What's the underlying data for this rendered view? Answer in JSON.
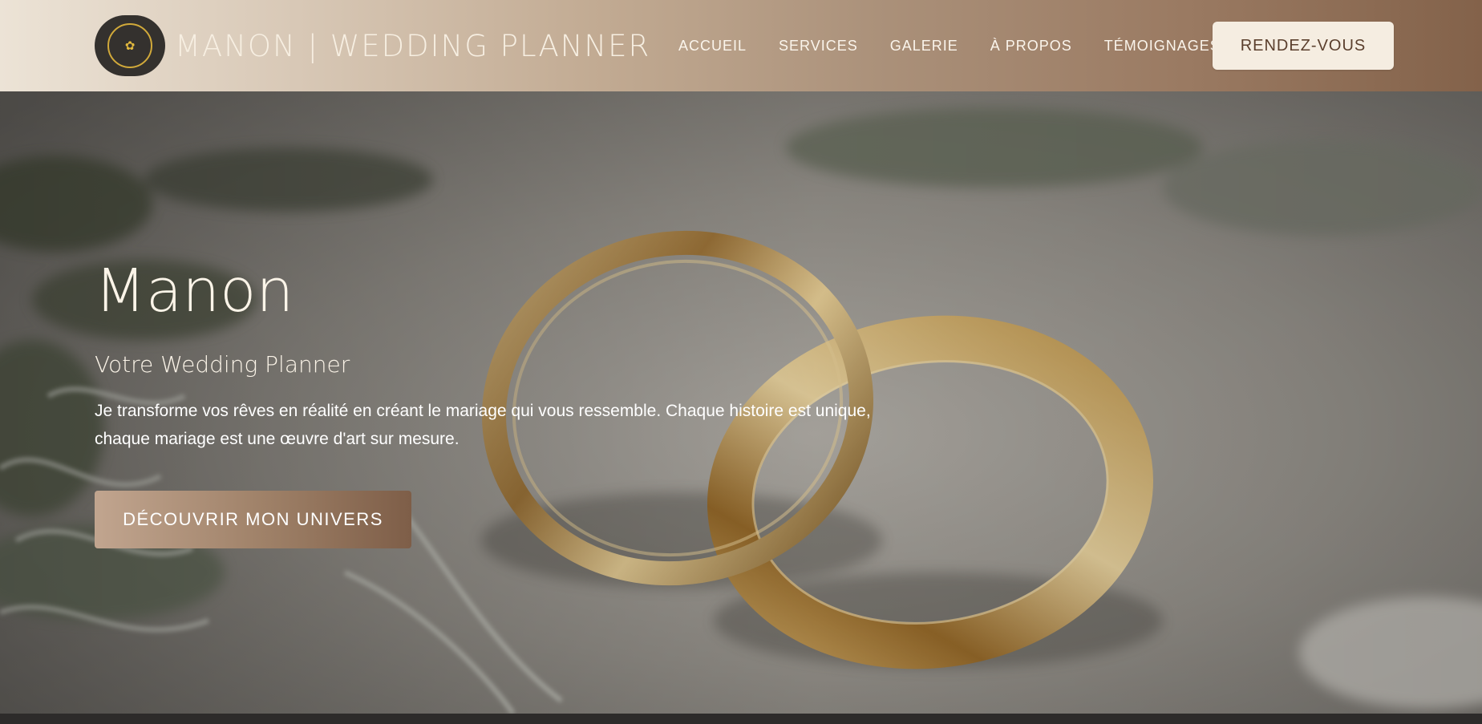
{
  "brand": {
    "logo_icon": "flower-icon",
    "logo_glyph": "✿",
    "name": "MANON | WEDDING PLANNER"
  },
  "nav": {
    "items": [
      {
        "label": "ACCUEIL"
      },
      {
        "label": "SERVICES"
      },
      {
        "label": "GALERIE"
      },
      {
        "label": "À PROPOS"
      },
      {
        "label": "TÉMOIGNAGES"
      }
    ],
    "cta_label": "RENDEZ-VOUS"
  },
  "hero": {
    "background_image": "wedding-rings-photo",
    "title": "Manon",
    "subtitle": "Votre Wedding Planner",
    "description": "Je transforme vos rêves en réalité en créant le mariage qui vous ressemble. Chaque histoire est unique, chaque mariage est une œuvre d'art sur mesure.",
    "cta_label": "DÉCOUVRIR MON UNIVERS"
  },
  "colors": {
    "header_gradient_start": "#ece3d6",
    "header_gradient_end": "#83624a",
    "accent_gold": "#d1a93a",
    "logo_bg": "#34312e",
    "header_button_bg": "#f5ede1",
    "header_button_text": "#5b3f2d",
    "hero_text": "#fbf4e8"
  }
}
